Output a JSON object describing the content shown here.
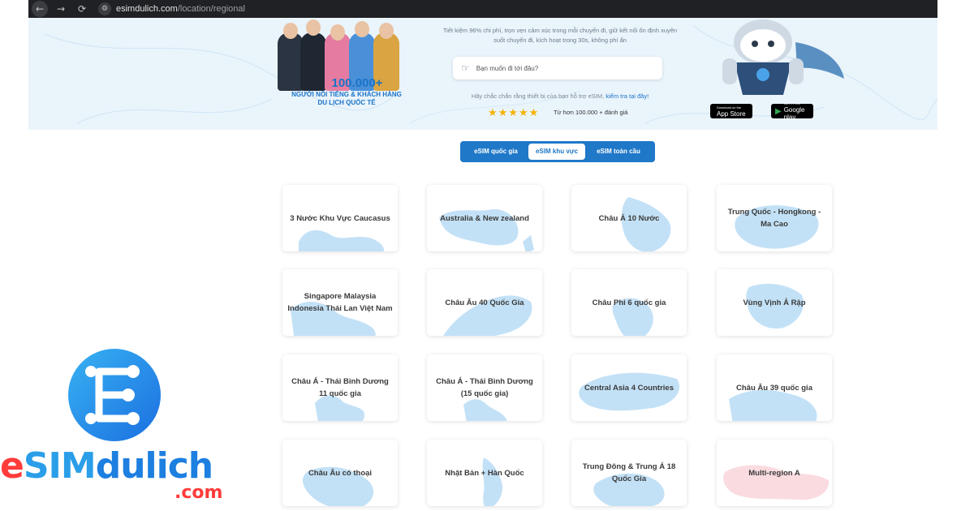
{
  "browser": {
    "nav_back": "←",
    "nav_forward": "→",
    "reload": "⟳",
    "site_info": "⚙",
    "url_host": "esimdulich.com",
    "url_path": "/location/regional"
  },
  "hero": {
    "celeb_count": "100.000+",
    "celeb_caption_1": "NGƯỜI NỔI TIẾNG & KHÁCH HÀNG",
    "celeb_caption_2": "DU LỊCH QUỐC TẾ",
    "tagline_1": "Tiết kiệm 96% chi phí, trọn vẹn cảm xúc trong mỗi chuyến đi, giữ kết nối ổn định xuyên",
    "tagline_2": "suốt chuyến đi, kích hoạt trong 30s, không phí ẩn",
    "search_placeholder": "Bạn muốn đi tới đâu?",
    "compat_text": "Hãy chắc chắn rằng thiết bị của bạn hỗ trợ eSIM,",
    "compat_link": "kiểm tra tại đây!",
    "rating_stars": "★★★★★",
    "reviews_text": "Từ hơn 100.000 + đánh giá",
    "app_store_small": "Download on the",
    "app_store_big": "App Store",
    "google_play_small": "GET IT ON",
    "google_play_big": "Google play",
    "app_store_glyph": "",
    "google_play_glyph": "▶"
  },
  "tabs": [
    {
      "label": "eSIM quốc gia",
      "active": false
    },
    {
      "label": "eSIM khu vực",
      "active": true
    },
    {
      "label": "eSIM toàn cầu",
      "active": false
    }
  ],
  "regions": [
    "3 Nước Khu Vực Caucasus",
    "Australia & New zealand",
    "Châu Á 10 Nước",
    "Trung Quốc - Hongkong - Ma Cao",
    "Singapore Malaysia Indonesia Thái Lan Việt Nam",
    "Châu Âu 40 Quốc Gia",
    "Châu Phi 6 quốc gia",
    "Vùng Vịnh Ả Rập",
    "Châu Á - Thái Bình Dương 11 quốc gia",
    "Châu Á - Thái Bình Dương (15 quốc gia)",
    "Central Asia 4 Countries",
    "Châu Âu 39 quốc gia",
    "Châu Âu có thoại",
    "Nhật Bản + Hàn Quốc",
    "Trung Đông & Trung Á 18 Quốc Gia",
    "Multi-region A"
  ],
  "logo": {
    "part_e": "e",
    "part_sim": "SIM",
    "part_dulich": "dulich",
    "part_com": ".com"
  },
  "colors": {
    "primary_blue": "#1f78c8",
    "map_blue": "#b9dcf5",
    "map_pink": "#f9d6da",
    "logo_red": "#ff3b3b",
    "star_yellow": "#f5b301"
  }
}
